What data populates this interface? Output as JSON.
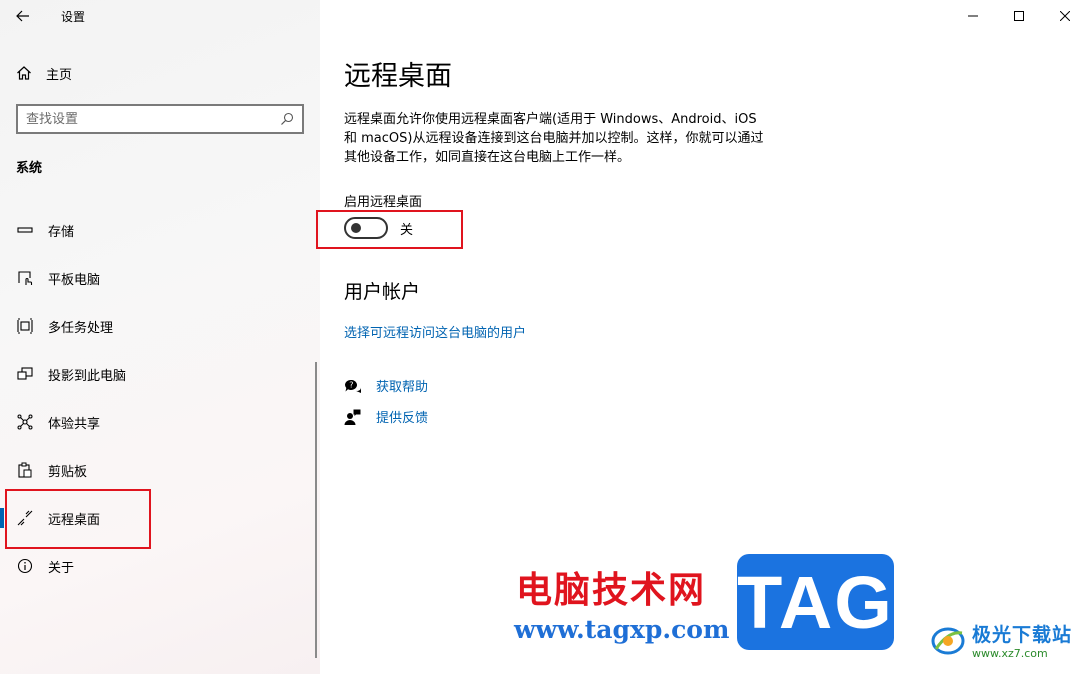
{
  "app": {
    "title": "设置"
  },
  "sidebar": {
    "home_label": "主页",
    "search_placeholder": "查找设置",
    "section_label": "系统",
    "items": [
      {
        "label": "存储",
        "icon": "storage-icon",
        "active": false
      },
      {
        "label": "平板电脑",
        "icon": "tablet-icon",
        "active": false
      },
      {
        "label": "多任务处理",
        "icon": "multitasking-icon",
        "active": false
      },
      {
        "label": "投影到此电脑",
        "icon": "project-icon",
        "active": false
      },
      {
        "label": "体验共享",
        "icon": "share-icon",
        "active": false
      },
      {
        "label": "剪贴板",
        "icon": "clipboard-icon",
        "active": false
      },
      {
        "label": "远程桌面",
        "icon": "remote-desktop-icon",
        "active": true
      },
      {
        "label": "关于",
        "icon": "info-icon",
        "active": false
      }
    ]
  },
  "main": {
    "title": "远程桌面",
    "description_lines": [
      "远程桌面允许你使用远程桌面客户端(适用于 Windows、Android、iOS",
      "和 macOS)从远程设备连接到这台电脑并加以控制。这样，你就可以通过",
      "其他设备工作，如同直接在这台电脑上工作一样。"
    ],
    "toggle": {
      "label": "启用远程桌面",
      "state": "关",
      "on": false
    },
    "user_accounts": {
      "title": "用户帐户",
      "link": "选择可远程访问这台电脑的用户"
    },
    "help_label": "获取帮助",
    "feedback_label": "提供反馈"
  },
  "watermark": {
    "site_cn": "电脑技术网",
    "site_url": "www.tagxp.com",
    "tag": "TAG",
    "jg_cn": "极光下载站",
    "jg_url": "www.xz7.com"
  },
  "colors": {
    "accent": "#0063b1",
    "highlight": "#e0141e"
  }
}
